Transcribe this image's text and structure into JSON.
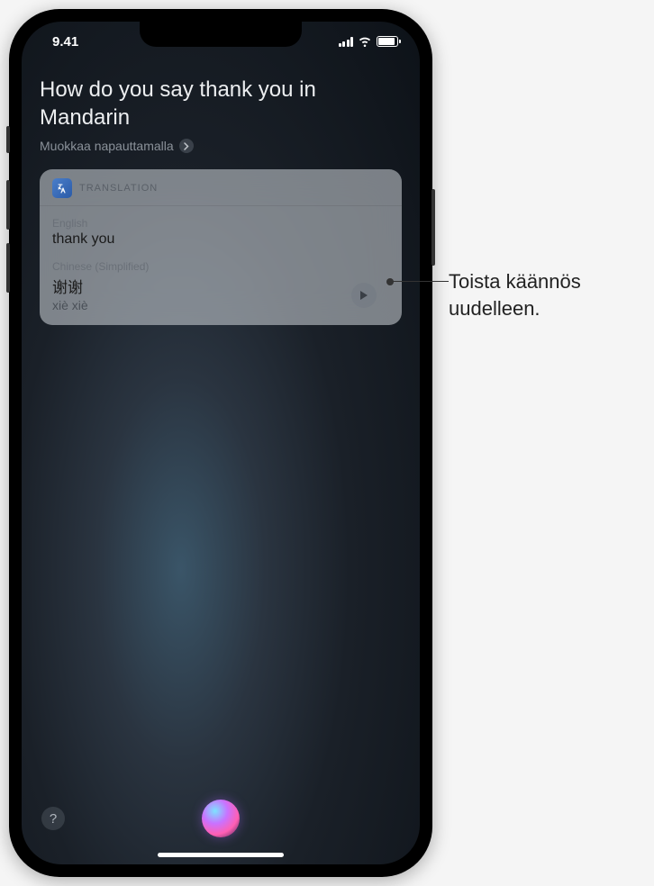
{
  "status_bar": {
    "time": "9.41"
  },
  "siri": {
    "user_query": "How do you say thank you in Mandarin",
    "edit_hint": "Muokkaa napauttamalla"
  },
  "translation_card": {
    "app_label": "TRANSLATION",
    "source": {
      "language": "English",
      "text": "thank you"
    },
    "target": {
      "language": "Chinese (Simplified)",
      "text": "谢谢",
      "romanization": "xiè xiè"
    }
  },
  "help_button": {
    "label": "?"
  },
  "callout": {
    "line1": "Toista käännös",
    "line2": "uudelleen."
  }
}
